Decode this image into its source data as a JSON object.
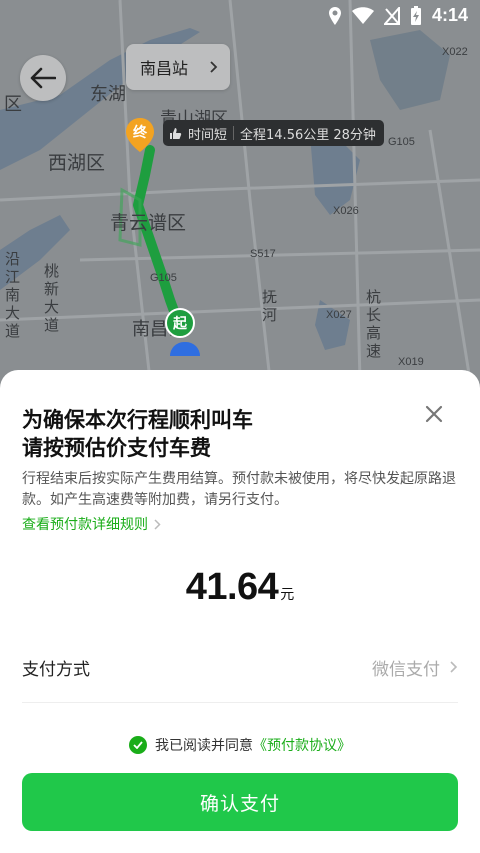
{
  "status_bar": {
    "time": "4:14"
  },
  "map": {
    "station_chip": "南昌站",
    "route_tag_text": "时间短",
    "route_summary": "全程14.56公里 28分钟",
    "end_marker": "终",
    "start_marker": "起",
    "districts": [
      "东湖",
      "西湖区",
      "青山湖区",
      "青云谱区",
      "南昌县",
      "区",
      "沿江南大道",
      "桃新大道",
      "抚河",
      "杭长高速"
    ],
    "road_tags": [
      "X022",
      "G105",
      "X026",
      "S517",
      "X027",
      "G105",
      "X019"
    ]
  },
  "sheet": {
    "title_line1": "为确保本次行程顺利叫车",
    "title_line2": "请按预估价支付车费",
    "description": "行程结束后按实际产生费用结算。预付款未被使用，将尽快发起原路退款。如产生高速费等附加费，请另行支付。",
    "rules_link": "查看预付款详细规则",
    "amount": "41.64",
    "amount_unit": "元",
    "payment_method_label": "支付方式",
    "payment_method_value": "微信支付",
    "agree_text": "我已阅读并同意",
    "agree_link": "《预付款协议》",
    "confirm_button": "确认支付"
  },
  "colors": {
    "accent_green": "#20c84a",
    "link_green": "#1aad19",
    "route_green": "#1e9e3f",
    "end_marker": "#f3a321"
  }
}
